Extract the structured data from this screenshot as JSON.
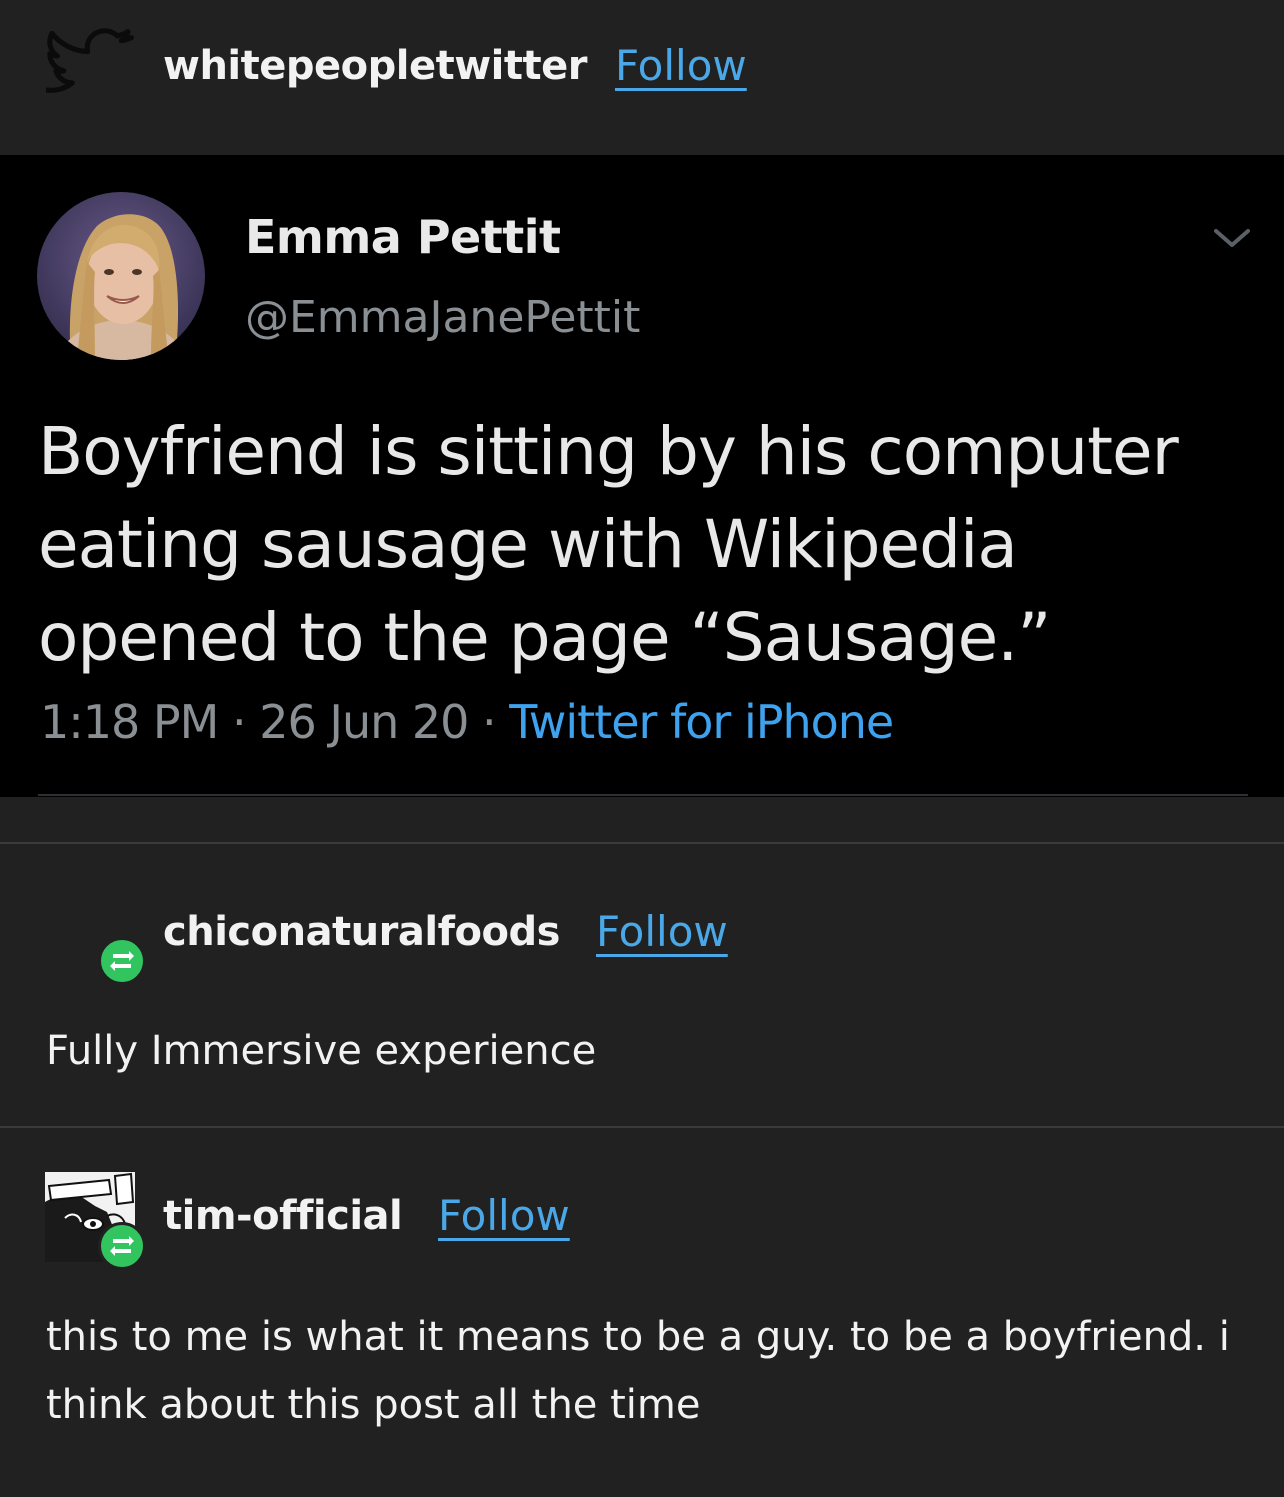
{
  "header": {
    "blog_name": "whitepeopletwitter",
    "follow_label": "Follow",
    "icon": "twitter-bird-icon"
  },
  "tweet": {
    "display_name": "Emma Pettit",
    "handle": "@EmmaJanePettit",
    "text": "Boyfriend is sitting by his computer eating sausage with Wikipedia opened to the page “Sausage.”",
    "time": "1:18 PM",
    "separator": "·",
    "date": "26 Jun 20",
    "source": "Twitter for iPhone",
    "menu_icon": "chevron-down-icon"
  },
  "reblogs": [
    {
      "username": "chiconaturalfoods",
      "follow_label": "Follow",
      "text": "Fully Immersive experience",
      "badge_icon": "reblog-icon"
    },
    {
      "username": "tim-official",
      "follow_label": "Follow",
      "text": "this to me is what it means to be a guy. to be a boyfriend. i think about this post all the time",
      "badge_icon": "reblog-icon"
    }
  ],
  "colors": {
    "background": "#212121",
    "tweet_background": "#000000",
    "link_blue": "#4aa8e8",
    "reblog_green": "#32c45f",
    "muted_gray": "#8a8f94"
  }
}
